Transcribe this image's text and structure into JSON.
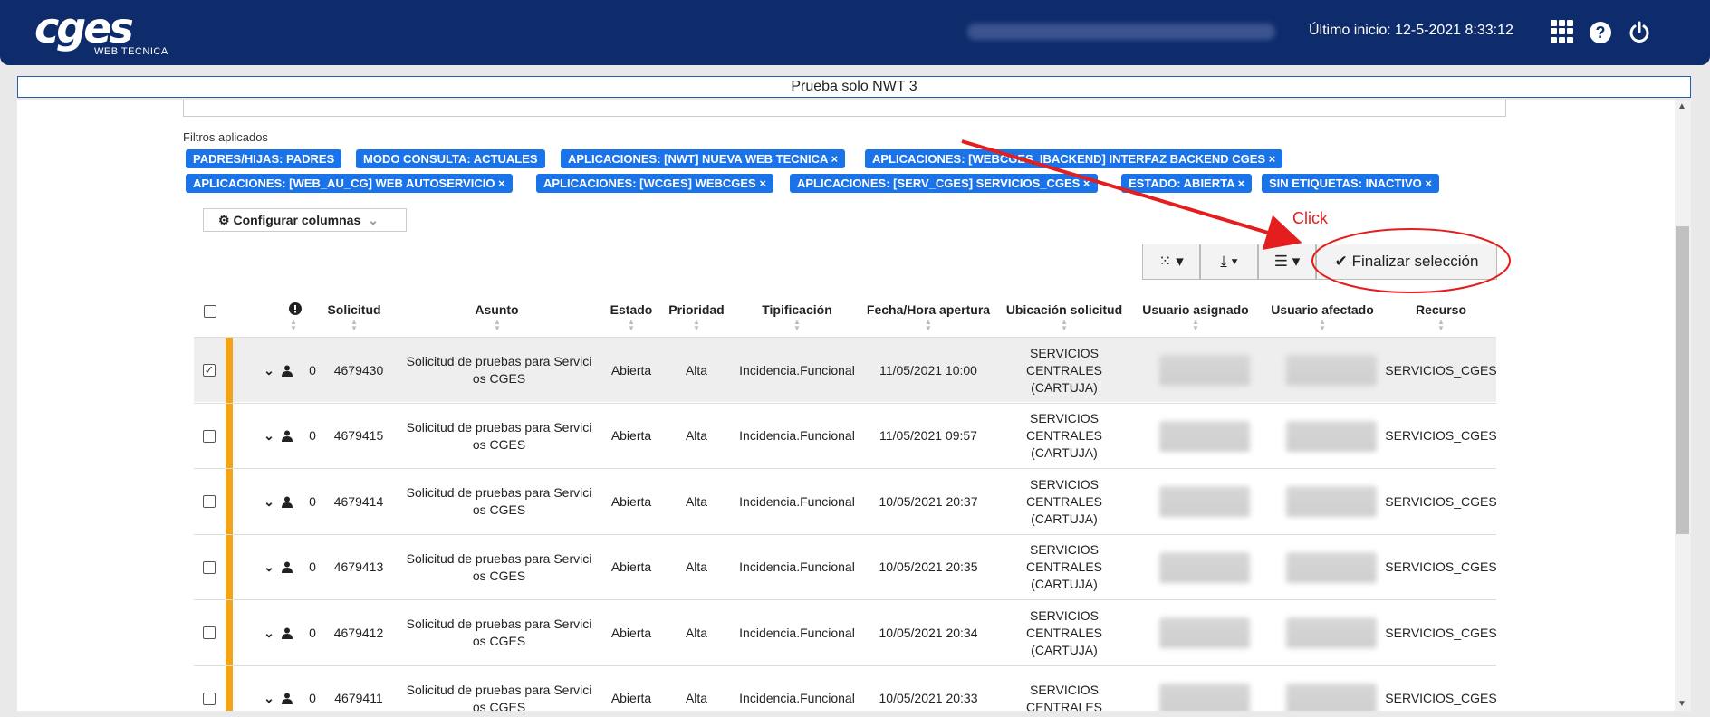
{
  "header": {
    "logo_text": "cges",
    "logo_subtitle": "WEB TECNICA",
    "last_login": "Último inicio: 12-5-2021 8:33:12"
  },
  "banner": {
    "title": "Prueba solo NWT 3"
  },
  "filters": {
    "title": "Filtros aplicados",
    "tags": [
      "PADRES/HIJAS: PADRES",
      "MODO CONSULTA: ACTUALES",
      "APLICACIONES: [NWT] NUEVA WEB TECNICA ×",
      "APLICACIONES: [WEBCGES_IBACKEND] INTERFAZ BACKEND CGES ×",
      "APLICACIONES: [WEB_AU_CG] WEB AUTOSERVICIO ×",
      "APLICACIONES: [WCGES] WEBCGES ×",
      "APLICACIONES: [SERV_CGES] SERVICIOS_CGES ×",
      "ESTADO: ABIERTA ×",
      "SIN ETIQUETAS: INACTIVO ×"
    ]
  },
  "toolbar": {
    "configure_columns": "Configurar columnas",
    "finish_selection": "Finalizar selección"
  },
  "annotation": {
    "label": "Click",
    "color": "#e41e1e"
  },
  "table": {
    "columns": [
      "Solicitud",
      "Asunto",
      "Estado",
      "Prioridad",
      "Tipificación",
      "Fecha/Hora apertura",
      "Ubicación solicitud",
      "Usuario asignado",
      "Usuario afectado",
      "Recurso"
    ],
    "rows": [
      {
        "checked": true,
        "count": "0",
        "id": "4679430",
        "asunto": "Solicitud de pruebas para Servici os CGES",
        "estado": "Abierta",
        "prioridad": "Alta",
        "tipificacion": "Incidencia.Funcional",
        "fecha": "11/05/2021 10:00",
        "ubicacion": "SERVICIOS CENTRALES (CARTUJA)",
        "recurso": "SERVICIOS_CGES"
      },
      {
        "checked": false,
        "count": "0",
        "id": "4679415",
        "asunto": "Solicitud de pruebas para Servici os CGES",
        "estado": "Abierta",
        "prioridad": "Alta",
        "tipificacion": "Incidencia.Funcional",
        "fecha": "11/05/2021 09:57",
        "ubicacion": "SERVICIOS CENTRALES (CARTUJA)",
        "recurso": "SERVICIOS_CGES"
      },
      {
        "checked": false,
        "count": "0",
        "id": "4679414",
        "asunto": "Solicitud de pruebas para Servici os CGES",
        "estado": "Abierta",
        "prioridad": "Alta",
        "tipificacion": "Incidencia.Funcional",
        "fecha": "10/05/2021 20:37",
        "ubicacion": "SERVICIOS CENTRALES (CARTUJA)",
        "recurso": "SERVICIOS_CGES"
      },
      {
        "checked": false,
        "count": "0",
        "id": "4679413",
        "asunto": "Solicitud de pruebas para Servici os CGES",
        "estado": "Abierta",
        "prioridad": "Alta",
        "tipificacion": "Incidencia.Funcional",
        "fecha": "10/05/2021 20:35",
        "ubicacion": "SERVICIOS CENTRALES (CARTUJA)",
        "recurso": "SERVICIOS_CGES"
      },
      {
        "checked": false,
        "count": "0",
        "id": "4679412",
        "asunto": "Solicitud de pruebas para Servici os CGES",
        "estado": "Abierta",
        "prioridad": "Alta",
        "tipificacion": "Incidencia.Funcional",
        "fecha": "10/05/2021 20:34",
        "ubicacion": "SERVICIOS CENTRALES (CARTUJA)",
        "recurso": "SERVICIOS_CGES"
      },
      {
        "checked": false,
        "count": "0",
        "id": "4679411",
        "asunto": "Solicitud de pruebas para Servici os CGES",
        "estado": "Abierta",
        "prioridad": "Alta",
        "tipificacion": "Incidencia.Funcional",
        "fecha": "10/05/2021 20:33",
        "ubicacion": "SERVICIOS CENTRALES",
        "recurso": "SERVICIOS_CGES"
      }
    ]
  }
}
